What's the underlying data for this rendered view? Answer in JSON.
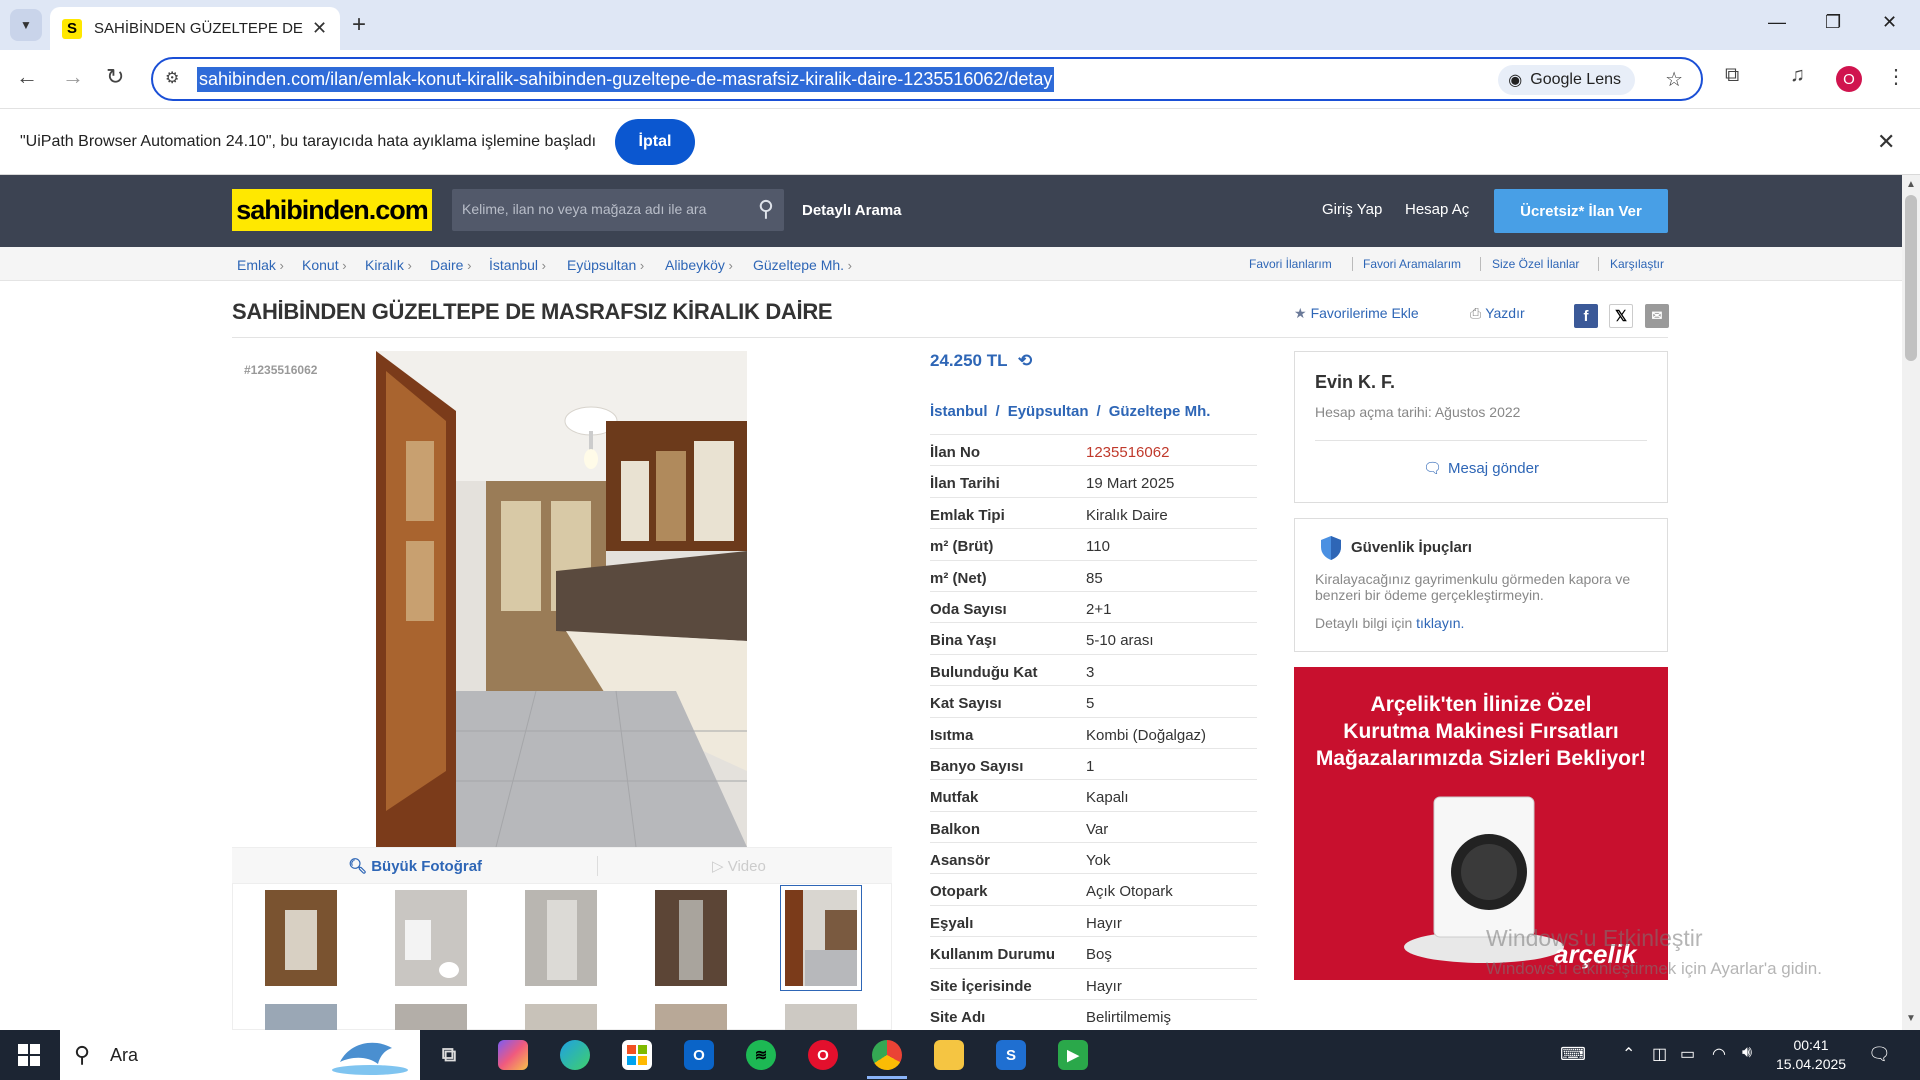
{
  "browser": {
    "tab_title": "SAHİBİNDEN GÜZELTEPE DE MASRAFSIZ KİRALIK DAİRE",
    "tab_favicon": "S",
    "url": "sahibinden.com/ilan/emlak-konut-kiralik-sahibinden-guzeltepe-de-masrafsiz-kiralik-daire-1235516062/detay",
    "lens_label": "Google Lens",
    "profile_initial": "O",
    "infobar_message": "\"UiPath Browser Automation 24.10\", bu tarayıcıda hata ayıklama işlemine başladı",
    "infobar_cancel": "İptal"
  },
  "site": {
    "logo": "sahibinden.com",
    "search_placeholder": "Kelime, ilan no veya mağaza adı ile ara",
    "detailed_search": "Detaylı Arama",
    "login": "Giriş Yap",
    "register": "Hesap Aç",
    "post_ad": "Ücretsiz* İlan Ver",
    "breadcrumbs": [
      "Emlak",
      "Konut",
      "Kiralık",
      "Daire",
      "İstanbul",
      "Eyüpsultan",
      "Alibeyköy",
      "Güzeltepe Mh."
    ],
    "right_links": [
      "Favori İlanlarım",
      "Favori Aramalarım",
      "Size Özel İlanlar",
      "Karşılaştır"
    ]
  },
  "listing": {
    "title": "SAHİBİNDEN GÜZELTEPE DE MASRAFSIZ KİRALIK DAİRE",
    "add_favorite": "Favorilerime Ekle",
    "print": "Yazdır",
    "id_tag": "#1235516062",
    "big_photo": "Büyük Fotoğraf",
    "video": "Video",
    "price": "24.250 TL",
    "location": [
      "İstanbul",
      "Eyüpsultan",
      "Güzeltepe Mh."
    ],
    "details": [
      {
        "k": "İlan No",
        "v": "1235516062"
      },
      {
        "k": "İlan Tarihi",
        "v": "19 Mart 2025"
      },
      {
        "k": "Emlak Tipi",
        "v": "Kiralık Daire"
      },
      {
        "k": "m² (Brüt)",
        "v": "110"
      },
      {
        "k": "m² (Net)",
        "v": "85"
      },
      {
        "k": "Oda Sayısı",
        "v": "2+1"
      },
      {
        "k": "Bina Yaşı",
        "v": "5-10 arası"
      },
      {
        "k": "Bulunduğu Kat",
        "v": "3"
      },
      {
        "k": "Kat Sayısı",
        "v": "5"
      },
      {
        "k": "Isıtma",
        "v": "Kombi (Doğalgaz)"
      },
      {
        "k": "Banyo Sayısı",
        "v": "1"
      },
      {
        "k": "Mutfak",
        "v": "Kapalı"
      },
      {
        "k": "Balkon",
        "v": "Var"
      },
      {
        "k": "Asansör",
        "v": "Yok"
      },
      {
        "k": "Otopark",
        "v": "Açık Otopark"
      },
      {
        "k": "Eşyalı",
        "v": "Hayır"
      },
      {
        "k": "Kullanım Durumu",
        "v": "Boş"
      },
      {
        "k": "Site İçerisinde",
        "v": "Hayır"
      },
      {
        "k": "Site Adı",
        "v": "Belirtilmemiş"
      }
    ]
  },
  "seller": {
    "name": "Evin K. F.",
    "since": "Hesap açma tarihi: Ağustos 2022",
    "message": "Mesaj gönder"
  },
  "safety": {
    "title": "Güvenlik İpuçları",
    "text": "Kiralayacağınız gayrimenkulu görmeden kapora ve benzeri bir ödeme gerçekleştirmeyin.",
    "more_prefix": "Detaylı bilgi için",
    "more_link": "tıklayın."
  },
  "ad": {
    "line1": "Arçelik'ten İlinize Özel",
    "line2": "Kurutma Makinesi Fırsatları",
    "line3": "Mağazalarımızda Sizleri Bekliyor!",
    "brand": "arçelik"
  },
  "watermark": {
    "line1": "Windows'u Etkinleştir",
    "line2": "Windows'u etkinleştirmek için Ayarlar'a gidin."
  },
  "taskbar": {
    "search": "Ara",
    "time": "00:41",
    "date": "15.04.2025"
  }
}
